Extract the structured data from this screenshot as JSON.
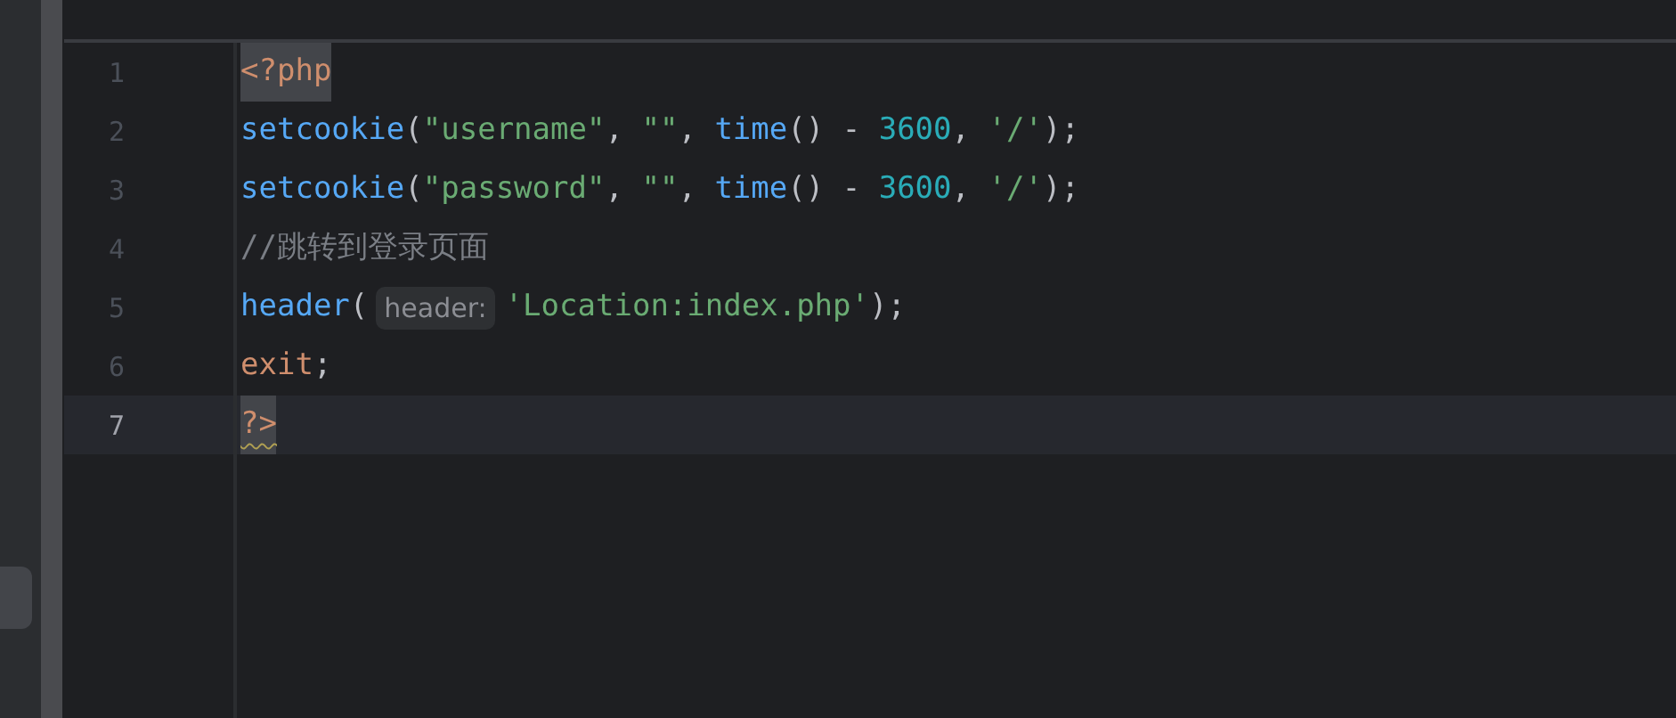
{
  "editor": {
    "lines": [
      {
        "number": "1",
        "current": false,
        "tokens": [
          {
            "text": "<?php",
            "kind": "keyword",
            "highlighted": true,
            "warning": false
          }
        ]
      },
      {
        "number": "2",
        "current": false,
        "tokens": [
          {
            "text": "setcookie",
            "kind": "function"
          },
          {
            "text": "(",
            "kind": "plain"
          },
          {
            "text": "\"username\"",
            "kind": "string"
          },
          {
            "text": ", ",
            "kind": "plain"
          },
          {
            "text": "\"\"",
            "kind": "string"
          },
          {
            "text": ", ",
            "kind": "plain"
          },
          {
            "text": "time",
            "kind": "function"
          },
          {
            "text": "() - ",
            "kind": "plain"
          },
          {
            "text": "3600",
            "kind": "number"
          },
          {
            "text": ", ",
            "kind": "plain"
          },
          {
            "text": "'/'",
            "kind": "string"
          },
          {
            "text": ");",
            "kind": "plain"
          }
        ]
      },
      {
        "number": "3",
        "current": false,
        "tokens": [
          {
            "text": "setcookie",
            "kind": "function"
          },
          {
            "text": "(",
            "kind": "plain"
          },
          {
            "text": "\"password\"",
            "kind": "string"
          },
          {
            "text": ", ",
            "kind": "plain"
          },
          {
            "text": "\"\"",
            "kind": "string"
          },
          {
            "text": ", ",
            "kind": "plain"
          },
          {
            "text": "time",
            "kind": "function"
          },
          {
            "text": "() - ",
            "kind": "plain"
          },
          {
            "text": "3600",
            "kind": "number"
          },
          {
            "text": ", ",
            "kind": "plain"
          },
          {
            "text": "'/'",
            "kind": "string"
          },
          {
            "text": ");",
            "kind": "plain"
          }
        ]
      },
      {
        "number": "4",
        "current": false,
        "tokens": [
          {
            "text": "//跳转到登录页面",
            "kind": "comment"
          }
        ]
      },
      {
        "number": "5",
        "current": false,
        "tokens": [
          {
            "text": "header",
            "kind": "function"
          },
          {
            "text": "(",
            "kind": "plain"
          },
          {
            "text": "header:",
            "kind": "hint"
          },
          {
            "text": "'Location:index.php'",
            "kind": "string"
          },
          {
            "text": ");",
            "kind": "plain"
          }
        ]
      },
      {
        "number": "6",
        "current": false,
        "tokens": [
          {
            "text": "exit",
            "kind": "keyword"
          },
          {
            "text": ";",
            "kind": "plain"
          }
        ]
      },
      {
        "number": "7",
        "current": true,
        "tokens": [
          {
            "text": "?>",
            "kind": "keyword",
            "highlighted": true,
            "warning": true
          }
        ]
      }
    ]
  }
}
